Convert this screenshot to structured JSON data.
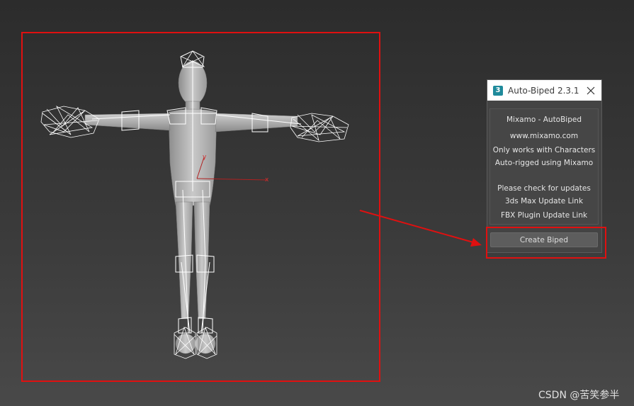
{
  "colors": {
    "highlight": "#e01010",
    "arrow": "#e01010",
    "dialog_bg": "#444444",
    "button_bg": "#5d5d5d",
    "app_icon": "#1f8a9b"
  },
  "viewport": {
    "figure": "t-pose-character-with-biped-rig",
    "gizmo": {
      "y_label": "y",
      "x_label": "x"
    }
  },
  "dialog": {
    "app_icon_text": "3",
    "title": "Auto-Biped 2.3.1",
    "close_icon": "close-icon",
    "info": {
      "line1": "Mixamo - AutoBiped",
      "line2": "www.mixamo.com",
      "line3": "Only works with Characters",
      "line4": "Auto-rigged using Mixamo",
      "line5": "Please check for updates",
      "line6": "3ds Max Update Link",
      "line7": "FBX Plugin Update Link"
    },
    "create_button_label": "Create Biped"
  },
  "annotations": {
    "arrow_icon": "arrow-right-icon"
  },
  "watermark": "CSDN @苦笑参半"
}
